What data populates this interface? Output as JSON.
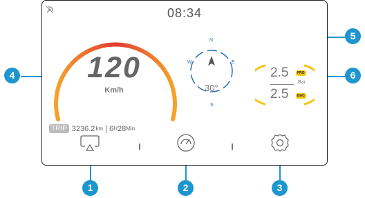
{
  "status": {
    "time": "08:34",
    "satellite_icon": "satellite-off-icon"
  },
  "speedometer": {
    "speed": "120",
    "unit": "Km/h",
    "gradient_colors": [
      "#e23b2e",
      "#f6a32c"
    ]
  },
  "trip": {
    "badge": "TRIP",
    "distance": "3236.2",
    "distance_unit": "km",
    "duration_hours": "6",
    "hours_unit": "H",
    "duration_minutes": "28",
    "minutes_unit": "Min"
  },
  "compass": {
    "north": "N",
    "south": "S",
    "east": "E",
    "west": "W",
    "heading": "30°",
    "color": "#2a6fb5"
  },
  "tire_pressure": {
    "front_value": "2.5",
    "front_tag": "FRO",
    "rear_value": "2.5",
    "rear_tag": "BAC",
    "unit": "Bar",
    "color": "#f5c518"
  },
  "toolbar": {
    "screen_mirror_icon": "screen-mirror-icon",
    "gauge_icon": "gauge-icon",
    "settings_icon": "gear-icon"
  },
  "callouts": {
    "c1": "1",
    "c2": "2",
    "c3": "3",
    "c4": "4",
    "c5": "5",
    "c6": "6",
    "color": "#1d95cf"
  }
}
